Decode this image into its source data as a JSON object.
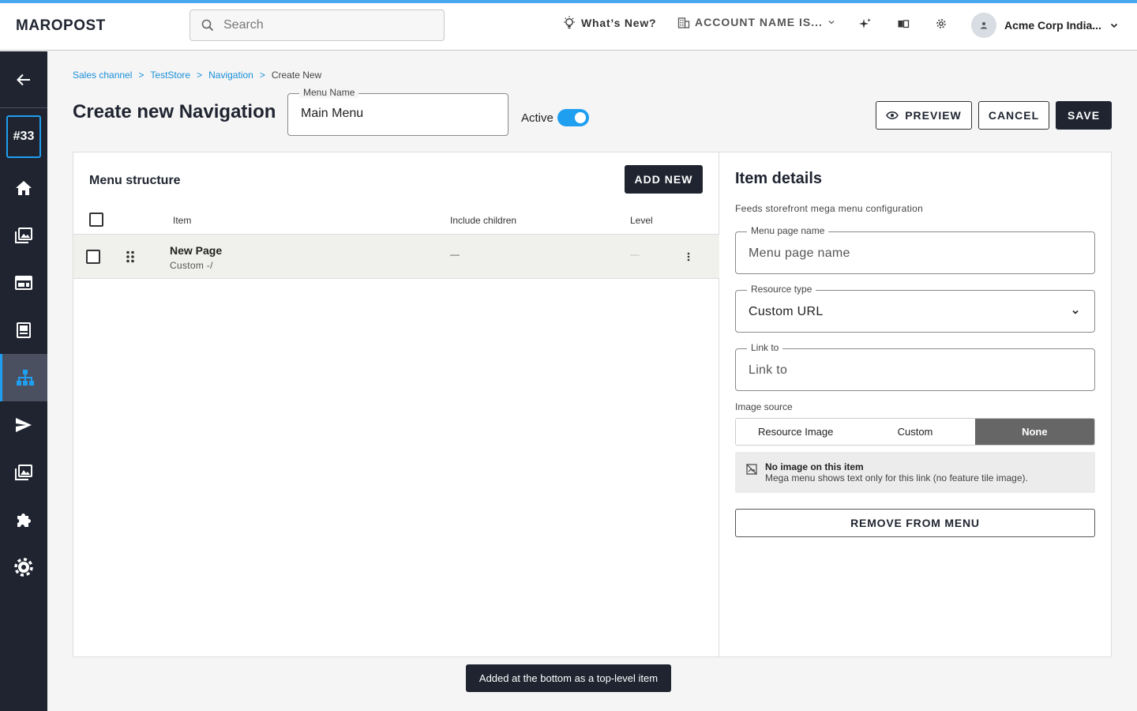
{
  "topbar": {
    "logo": "MAROPOST",
    "search_placeholder": "Search",
    "whats_new": "What’s New?",
    "account_name": "ACCOUNT NAME IS...",
    "user_name": "Acme Corp India..."
  },
  "sidebar": {
    "badge": "#33",
    "active_item": "navigation"
  },
  "breadcrumb": {
    "items": [
      "Sales channel",
      "TestStore",
      "Navigation"
    ],
    "separator": ">",
    "current": "Create New"
  },
  "header": {
    "title": "Create new Navigation",
    "menu_name_label": "Menu Name",
    "menu_name_value": "Main Menu",
    "active_label": "Active",
    "active": true,
    "preview_label": "PREVIEW",
    "cancel_label": "CANCEL",
    "save_label": "SAVE"
  },
  "menu_structure": {
    "title": "Menu structure",
    "add_new_label": "ADD NEW",
    "columns": [
      "Item",
      "Include children",
      "Level"
    ],
    "rows": [
      {
        "title": "New Page",
        "subtitle": "Custom -/",
        "include_children": "—",
        "level": "—"
      }
    ]
  },
  "item_details": {
    "title": "Item details",
    "subtitle": "Feeds storefront mega menu configuration",
    "menu_page_name_label": "Menu page name",
    "menu_page_name_placeholder": "Menu page name",
    "resource_type_label": "Resource type",
    "resource_type_value": "Custom URL",
    "link_to_label": "Link to",
    "link_to_placeholder": "Link to",
    "image_source_label": "Image source",
    "image_source_options": [
      "Resource Image",
      "Custom",
      "None"
    ],
    "image_source_selected": "None",
    "notice_title": "No image on this item",
    "notice_text": "Mega menu shows text only for this link (no feature tile image).",
    "remove_label": "REMOVE FROM MENU"
  },
  "toast": "Added at the bottom as a top-level item",
  "colors": {
    "accent": "#1f9ff0",
    "dark": "#1f2430",
    "top_line": "#4aa8f0"
  }
}
